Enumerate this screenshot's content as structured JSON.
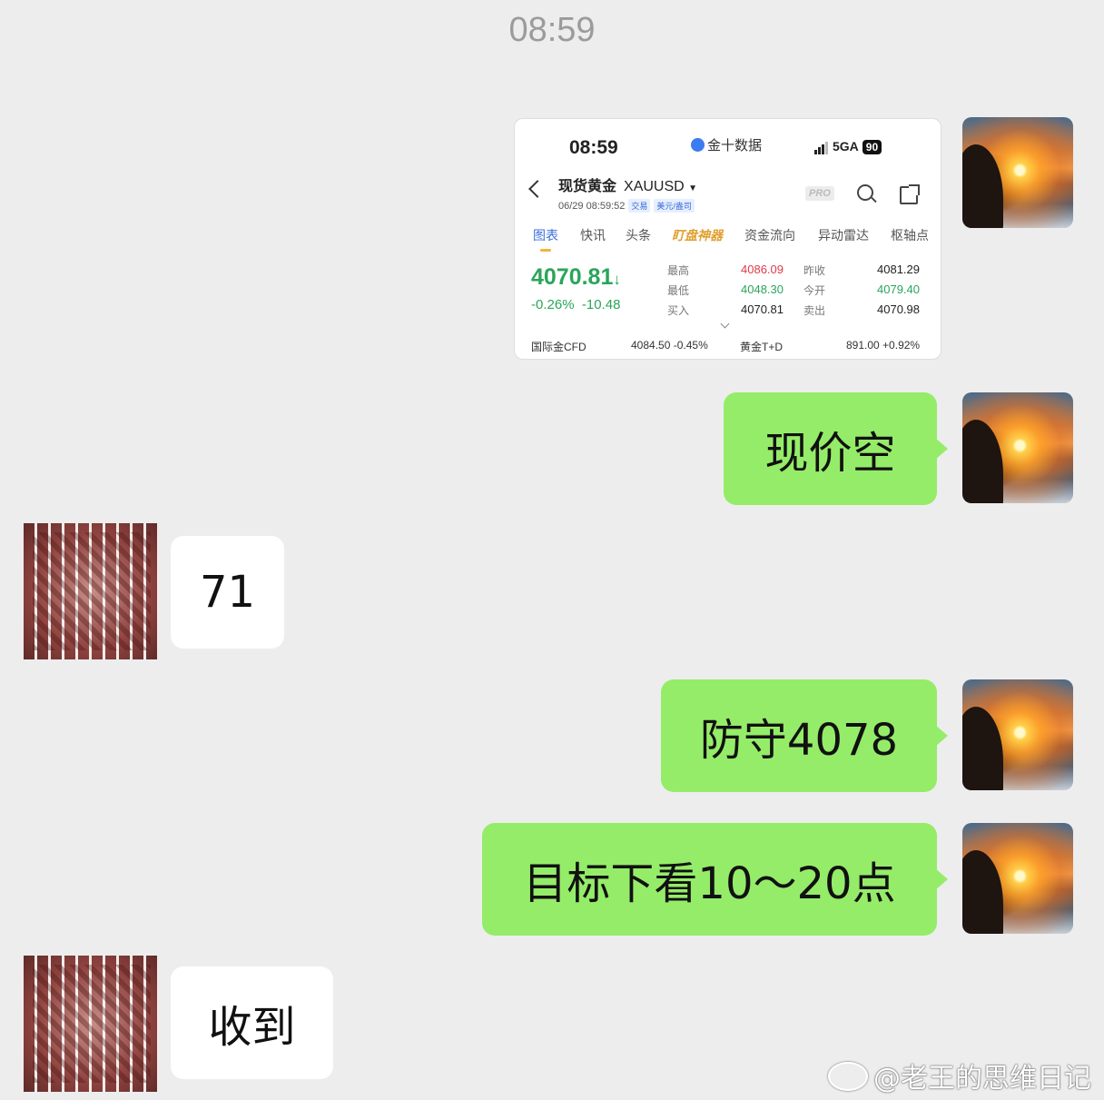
{
  "header": {
    "time": "08:59"
  },
  "screenshot": {
    "status_time": "08:59",
    "app_name": "金十数据",
    "network": "5GA",
    "battery": "90",
    "title": "现货黄金",
    "symbol": "XAUUSD",
    "datetime": "06/29 08:59:52",
    "tag1": "交易",
    "tag2": "美元/盎司",
    "pro": "PRO",
    "tabs": [
      "图表",
      "快讯",
      "头条",
      "盯盘神器",
      "资金流向",
      "异动雷达",
      "枢轴点"
    ],
    "price": "4070.81",
    "price_arrow": "↓",
    "change_pct": "-0.26%",
    "change_abs": "-10.48",
    "quotes": {
      "high_label": "最高",
      "high": "4086.09",
      "low_label": "最低",
      "low": "4048.30",
      "buy_label": "买入",
      "buy": "4070.81",
      "prev_label": "昨收",
      "prev": "4081.29",
      "open_label": "今开",
      "open": "4079.40",
      "sell_label": "卖出",
      "sell": "4070.98"
    },
    "footer": {
      "cfd_label": "国际金CFD",
      "cfd_value": "4084.50",
      "cfd_change": "-0.45%",
      "td_label": "黄金T+D",
      "td_value": "891.00",
      "td_change": "+0.92%"
    }
  },
  "messages": [
    {
      "side": "out",
      "text": "现价空"
    },
    {
      "side": "in",
      "text": "71"
    },
    {
      "side": "out",
      "text": "防守4078"
    },
    {
      "side": "out",
      "text": "目标下看10～20点"
    },
    {
      "side": "in",
      "text": "收到"
    }
  ],
  "watermark": "@老王的思维日记"
}
